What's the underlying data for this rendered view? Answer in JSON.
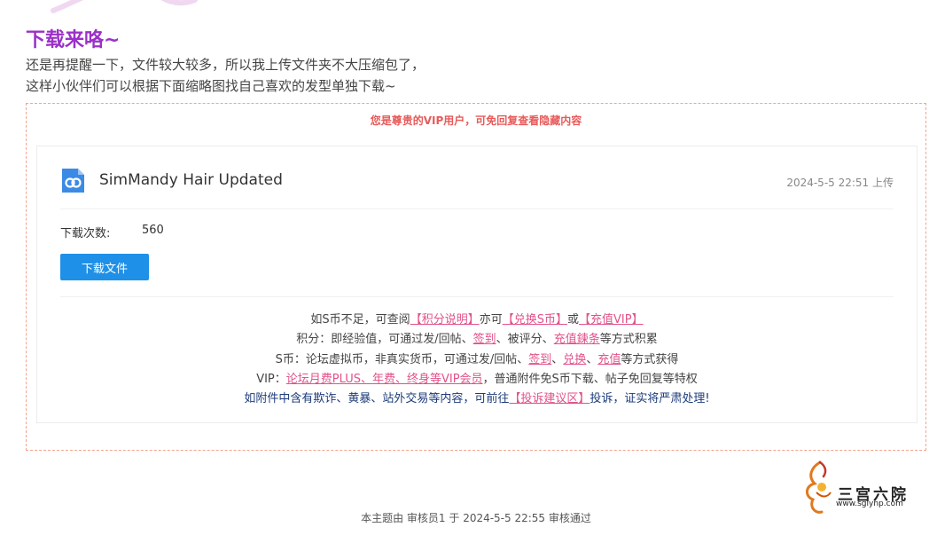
{
  "section": {
    "title": "下载来咯~",
    "intro_line1": "还是再提醒一下，文件较大较多，所以我上传文件夹不大压缩包了，",
    "intro_line2": "这样小伙伴们可以根据下面缩略图找自己喜欢的发型单独下载~"
  },
  "vip_notice": "您是尊贵的VIP用户，可免回复查看隐藏内容",
  "attachment": {
    "file_name": "SimMandy Hair Updated",
    "upload_time": "2024-5-5 22:51 上传",
    "download_count_label": "下载次数:",
    "download_count": "560",
    "download_button": "下载文件",
    "icon": "cloud-storage-icon"
  },
  "info": {
    "line1_prefix": "如S币不足，可查阅",
    "link_points": "【积分说明】",
    "line1_mid1": "亦可",
    "link_exchange_s": "【兑换S币】",
    "line1_mid2": "或",
    "link_recharge_vip": "【充值VIP】",
    "line2_prefix": "积分：即经验值，可通过发/回帖、",
    "link_checkin": "签到",
    "line2_mid": "、被评分、",
    "link_recharge_lianzhi": "充值鍊条",
    "line2_suffix": "等方式积累",
    "line3_prefix": "S币：论坛虚拟币，非真实货币，可通过发/回帖、",
    "link_checkin2": "签到",
    "line3_sep1": "、",
    "link_exchange": "兑换",
    "line3_sep2": "、",
    "link_recharge": "充值",
    "line3_suffix": "等方式获得",
    "line4_prefix": "VIP：",
    "link_vip_plans": "论坛月费PLUS、年费、终身等VIP会员",
    "line4_suffix": "，普通附件免S币下载、帖子免回复等特权",
    "line5_prefix": "如附件中含有欺诈、黄暴、站外交易等内容，可前往",
    "link_complaint": "【投诉建议区】",
    "line5_suffix": "投诉，证实将严肃处理!"
  },
  "logo": {
    "name": "三宫六院",
    "url": "www.sglynp.com"
  },
  "review_note": "本主题由 审核员1 于 2024-5-5 22:55 审核通过",
  "colors": {
    "title": "#9b30c8",
    "link": "#e2528a",
    "button": "#1e90e8",
    "notice": "#e85a5a",
    "border_dashed": "#f2a48f"
  }
}
